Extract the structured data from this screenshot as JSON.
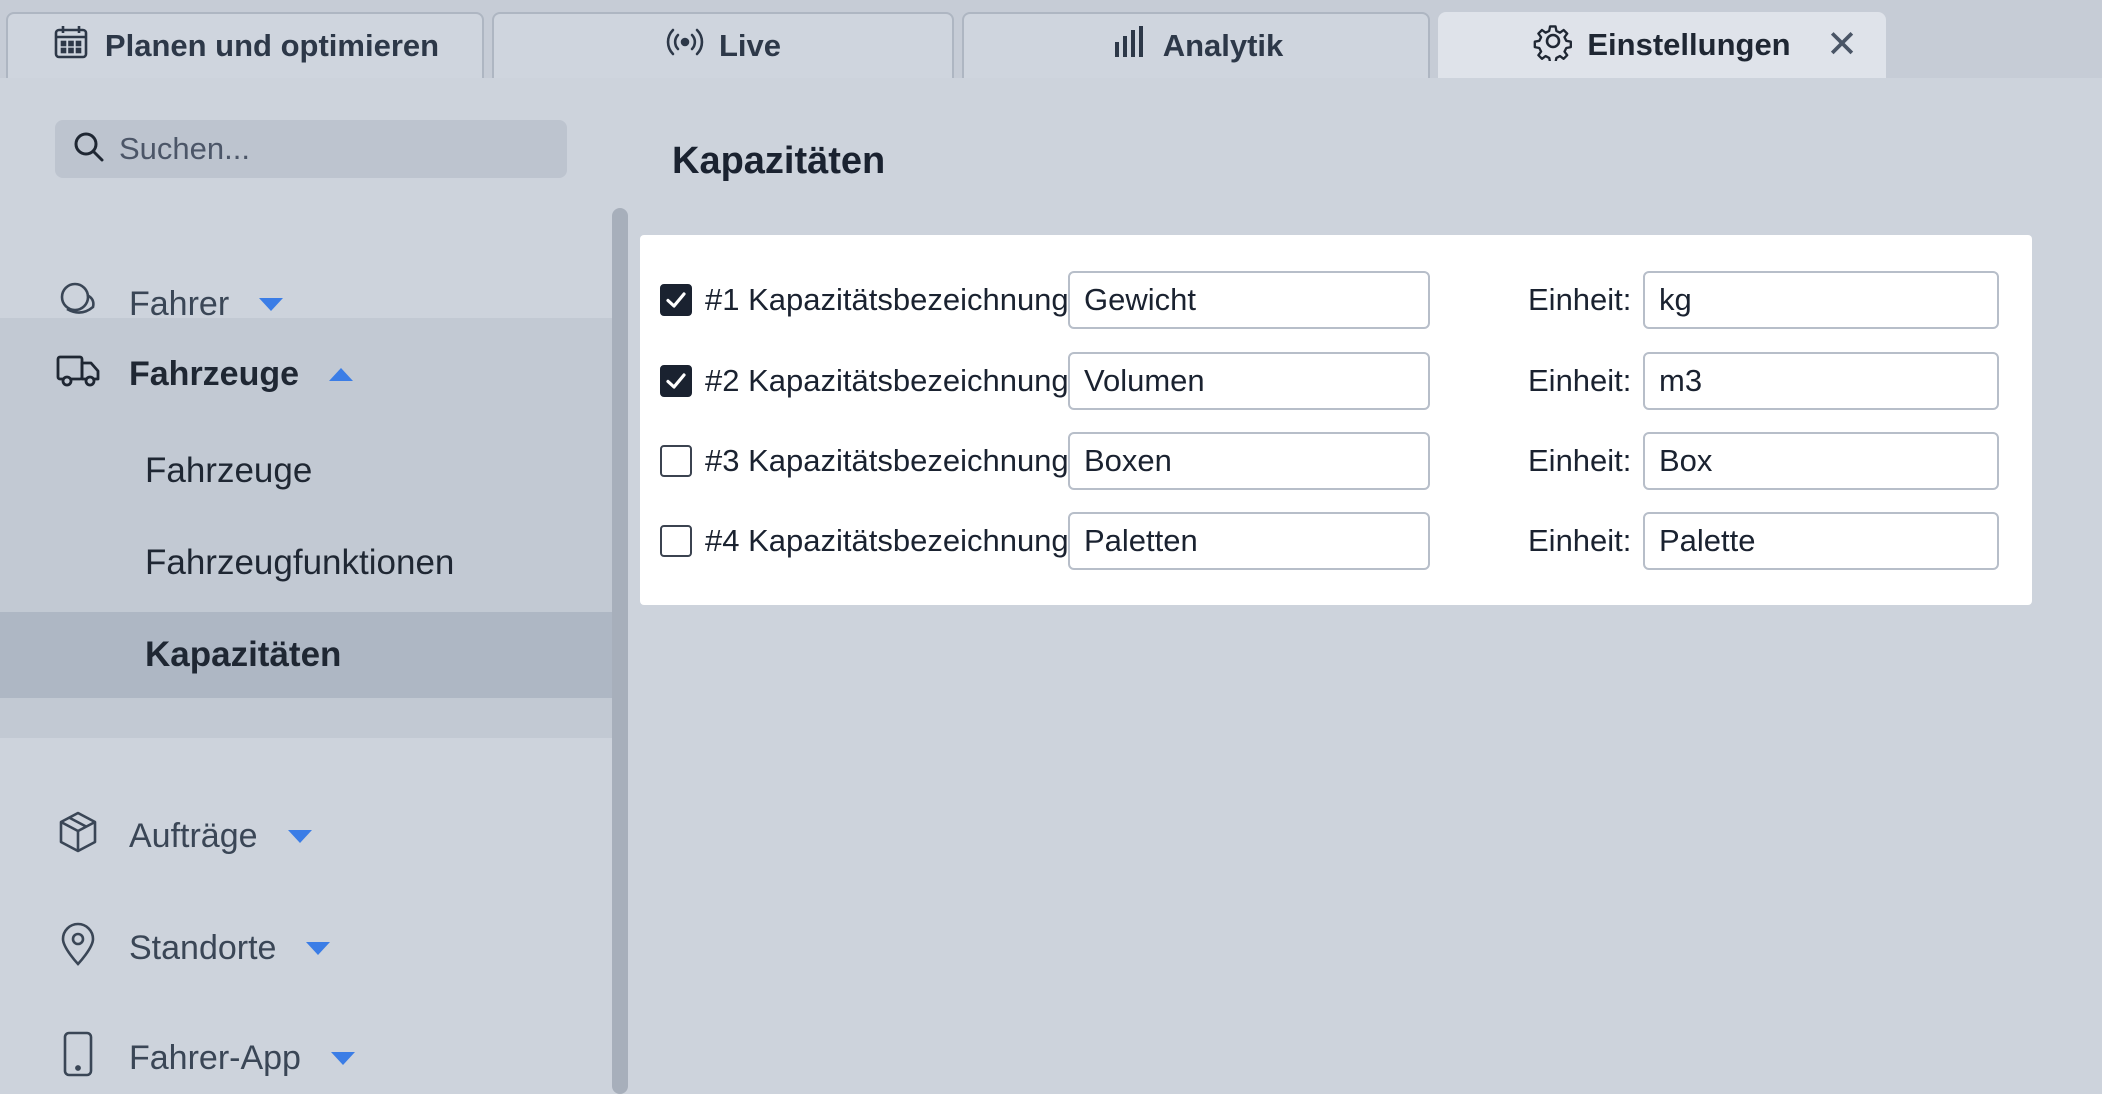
{
  "tabs": [
    {
      "label": "Planen und optimieren",
      "icon": "calendar-icon"
    },
    {
      "label": "Live",
      "icon": "broadcast-icon"
    },
    {
      "label": "Analytik",
      "icon": "bar-chart-icon"
    },
    {
      "label": "Einstellungen",
      "icon": "gear-icon",
      "active": true,
      "close": "✕"
    }
  ],
  "sidebar": {
    "search_placeholder": "Suchen...",
    "items": [
      {
        "label": "Fahrer",
        "icon": "fahrer-icon",
        "expanded": false
      },
      {
        "label": "Fahrzeuge",
        "icon": "truck-icon",
        "expanded": true,
        "children": [
          {
            "label": "Fahrzeuge"
          },
          {
            "label": "Fahrzeugfunktionen"
          },
          {
            "label": "Kapazitäten",
            "selected": true
          }
        ]
      },
      {
        "label": "Aufträge",
        "icon": "package-icon",
        "expanded": false
      },
      {
        "label": "Standorte",
        "icon": "location-pin-icon",
        "expanded": false
      },
      {
        "label": "Fahrer-App",
        "icon": "smartphone-icon",
        "expanded": false
      }
    ]
  },
  "main": {
    "title": "Kapazitäten",
    "unit_label": "Einheit:",
    "capacities": [
      {
        "label": "#1 Kapazitätsbezeichnung:",
        "checked": true,
        "name": "Gewicht",
        "unit": "kg"
      },
      {
        "label": "#2 Kapazitätsbezeichnung:",
        "checked": true,
        "name": "Volumen",
        "unit": "m3"
      },
      {
        "label": "#3 Kapazitätsbezeichnung:",
        "checked": false,
        "name": "Boxen",
        "unit": "Box"
      },
      {
        "label": "#4 Kapazitätsbezeichnung:",
        "checked": false,
        "name": "Paletten",
        "unit": "Palette"
      }
    ]
  },
  "colors": {
    "background": "#cdd3dc",
    "accent": "#3b7de6",
    "card": "#ffffff",
    "selected_item": "#aeb7c4"
  }
}
